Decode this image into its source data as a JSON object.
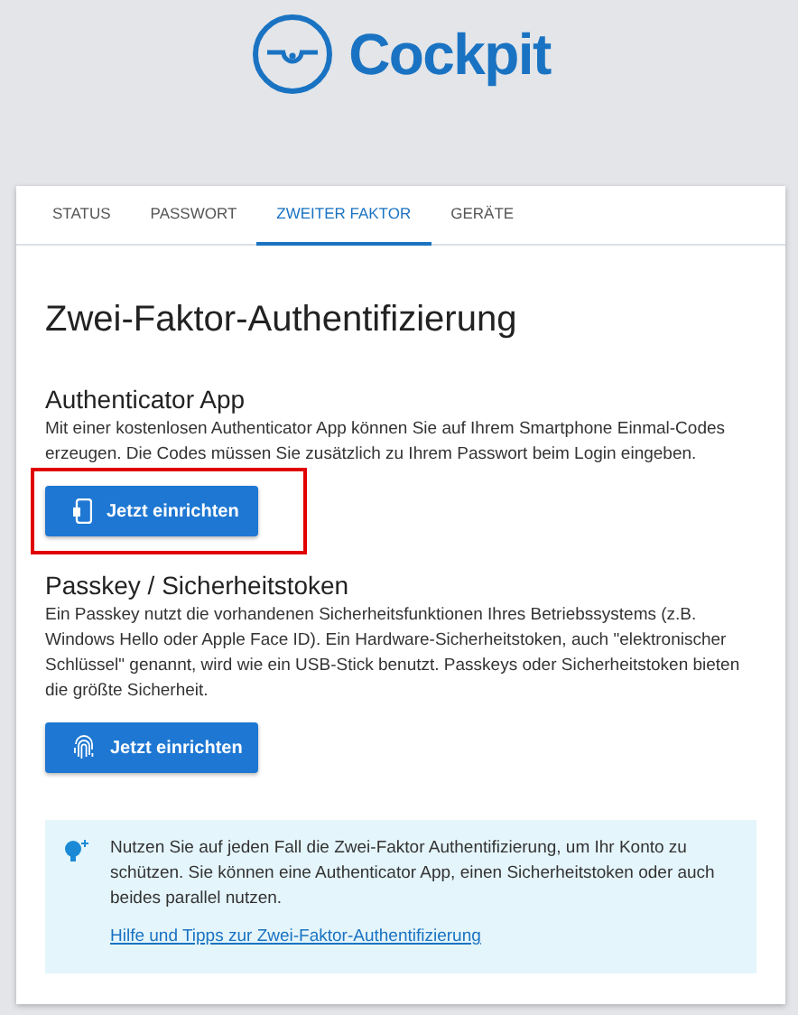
{
  "logo": {
    "text": "Cockpit"
  },
  "tabs": [
    {
      "label": "STATUS",
      "selected": false
    },
    {
      "label": "PASSWORT",
      "selected": false
    },
    {
      "label": "ZWEITER FAKTOR",
      "selected": true
    },
    {
      "label": "GERÄTE",
      "selected": false
    }
  ],
  "heading": "Zwei-Faktor-Authentifizierung",
  "sections": [
    {
      "title": "Authenticator App",
      "text": "Mit einer kostenlosen Authenticator App können Sie auf Ihrem Smartphone Einmal-Codes erzeugen. Die Codes müssen Sie zusätzlich zu Ihrem Passwort beim Login eingeben.",
      "button": {
        "label": "Jetzt einrichten",
        "kind": "phone",
        "highlighted": true
      }
    },
    {
      "title": "Passkey / Sicherheitstoken",
      "text": "Ein Passkey nutzt die vorhandenen Sicherheitsfunktionen Ihres Betriebssystems (z.B. Windows Hello oder Apple Face ID). Ein Hardware-Sicherheitstoken, auch \"elektronischer Schlüssel\" genannt, wird wie ein USB-Stick benutzt. Passkeys oder Sicherheitstoken bieten die größte Sicherheit.",
      "button": {
        "label": "Jetzt einrichten",
        "kind": "fingerprint",
        "highlighted": false
      }
    }
  ],
  "tip": {
    "text": "Nutzen Sie auf jeden Fall die Zwei-Faktor Authentifizierung, um Ihr Konto zu schützen. Sie können eine Authenticator App, einen Sicherheitstoken oder auch beides parallel nutzen.",
    "link": "Hilfe und Tipps zur Zwei-Faktor-Authentifizierung"
  }
}
